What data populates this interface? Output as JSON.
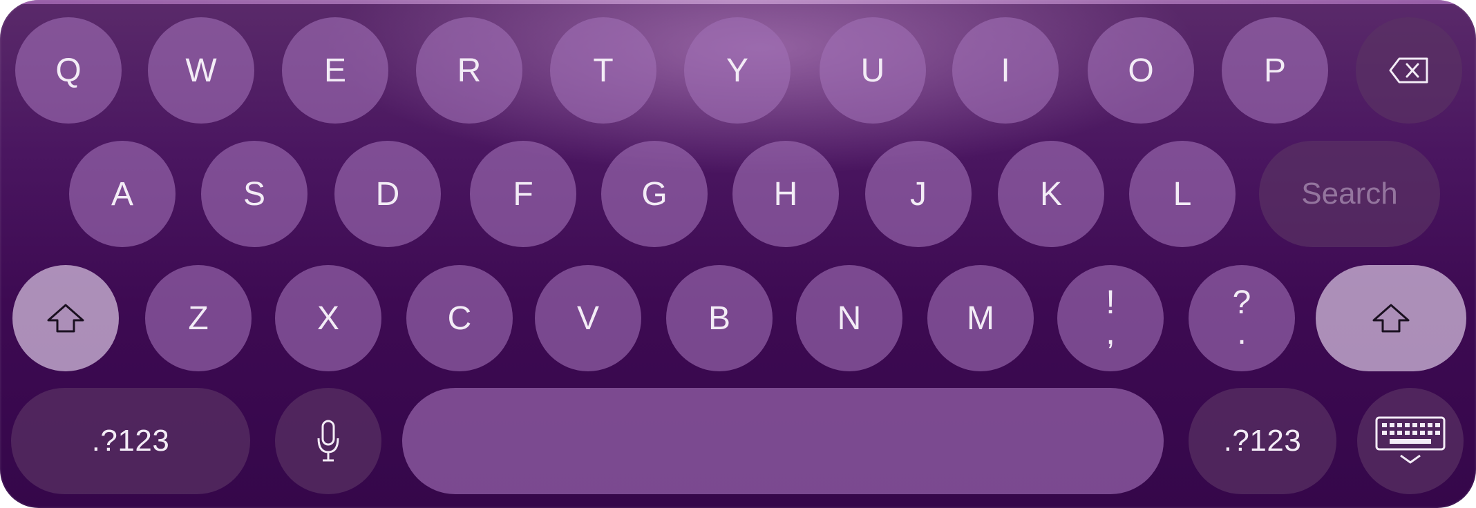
{
  "keyboard": {
    "row1": [
      "Q",
      "W",
      "E",
      "R",
      "T",
      "Y",
      "U",
      "I",
      "O",
      "P"
    ],
    "row2": [
      "A",
      "S",
      "D",
      "F",
      "G",
      "H",
      "J",
      "K",
      "L"
    ],
    "row3": [
      "Z",
      "X",
      "C",
      "V",
      "B",
      "N",
      "M"
    ],
    "punct1": {
      "top": "!",
      "bottom": ","
    },
    "punct2": {
      "top": "?",
      "bottom": "."
    },
    "search_label": "Search",
    "numbers_left": ".?123",
    "numbers_right": ".?123",
    "icons": {
      "backspace": "backspace-icon",
      "shift": "shift-icon",
      "microphone": "microphone-icon",
      "hide_keyboard": "keyboard-hide-icon"
    }
  }
}
